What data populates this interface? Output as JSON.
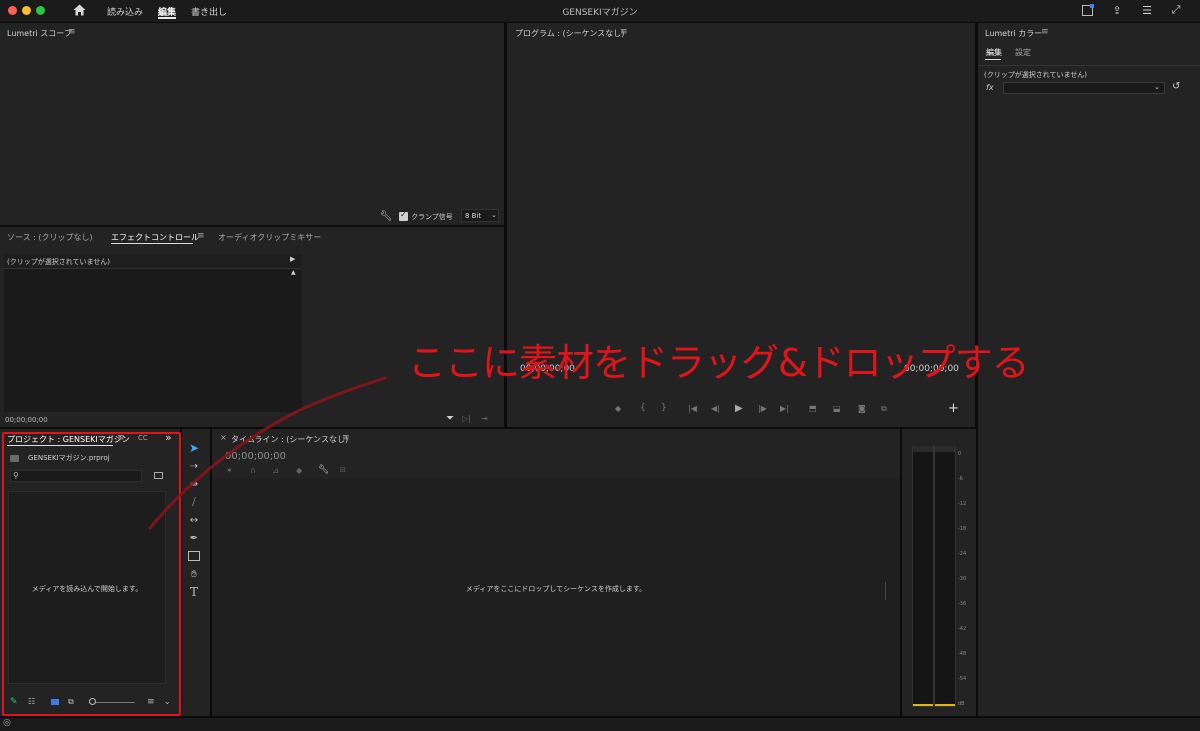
{
  "topbar": {
    "tabs": [
      "読み込み",
      "編集",
      "書き出し"
    ],
    "active_tab": 1,
    "title": "GENSEKIマガジン"
  },
  "lumetri_scope": {
    "title": "Lumetri スコープ",
    "clamp_label": "クランプ信号",
    "bit_select": "8 Bit"
  },
  "source_panel": {
    "tabs": [
      "ソース : (クリップなし)",
      "エフェクトコントロール",
      "オーディオクリップミキサー"
    ],
    "no_clip": "(クリップが選択されていません)",
    "timecode": "00;00;00;00"
  },
  "program": {
    "title": "プログラム : (シーケンスなし)",
    "timecode": "00;00;00;00",
    "timecode_right": "00;00;00;00"
  },
  "lumetri_color": {
    "title": "Lumetri カラー",
    "tabs": [
      "編集",
      "設定"
    ],
    "no_clip": "(クリップが選択されていません)",
    "fx_label": "fx"
  },
  "project": {
    "title": "プロジェクト : GENSEKIマガジン",
    "cc": "CC",
    "more": "»",
    "file_name": "GENSEKIマガジン.prproj",
    "search_placeholder": "",
    "empty_message": "メディアを読み込んで開始します。"
  },
  "timeline": {
    "close": "×",
    "title": "タイムライン : (シーケンスなし)",
    "timecode": "00;00;00;00",
    "empty_message": "メディアをここにドロップしてシーケンスを作成します。"
  },
  "audio_meter": {
    "ticks": [
      "0",
      "-6",
      "-12",
      "-18",
      "-24",
      "-30",
      "-36",
      "-42",
      "-48",
      "-54",
      "dB"
    ]
  },
  "annotation": {
    "text": "ここに素材をドラッグ&ドロップする",
    "color": "#e0141b"
  }
}
